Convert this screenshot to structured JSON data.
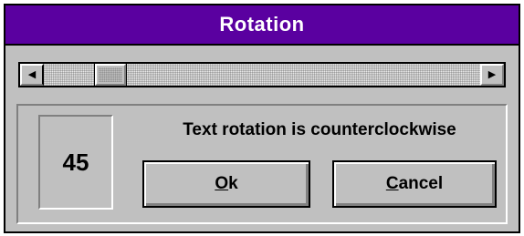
{
  "window": {
    "title": "Rotation",
    "title_bar_color": "#5a00a0",
    "face_color": "#c0c0c0"
  },
  "scrollbar": {
    "left_arrow": "◀",
    "right_arrow": "▶",
    "value": 45,
    "min": 0,
    "max": 360
  },
  "panel": {
    "value_display": "45",
    "message": "Text rotation is counterclockwise"
  },
  "buttons": {
    "ok": {
      "mnemonic": "O",
      "rest": "k"
    },
    "cancel": {
      "mnemonic": "C",
      "rest": "ancel"
    }
  }
}
